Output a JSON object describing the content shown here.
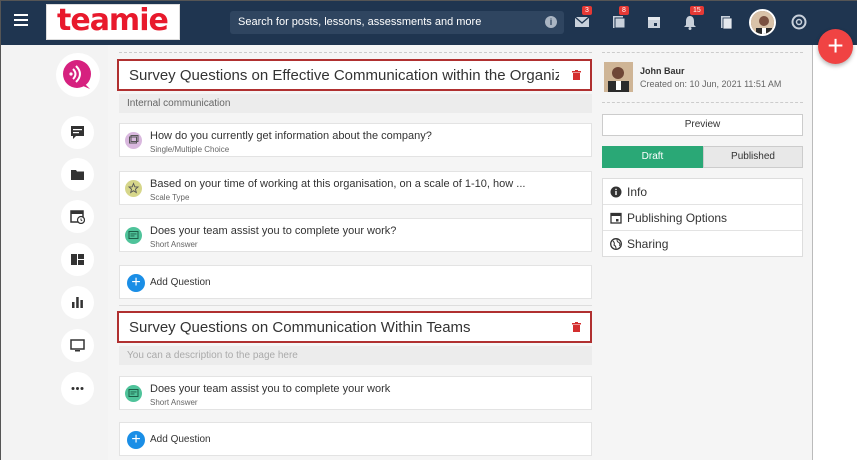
{
  "header": {
    "logo_text": "teamie",
    "search_placeholder": "Search for posts, lessons, assessments and more",
    "badges": {
      "messages": "3",
      "lessons": "8",
      "notifications": "15"
    }
  },
  "sections": [
    {
      "title": "Survey Questions on Effective Communication within the Organiz",
      "description": "Internal communication",
      "questions": [
        {
          "title": "How do you currently get information about the company?",
          "type": "Single/Multiple Choice",
          "color": "#d9b8de"
        },
        {
          "title": "Based on your time of working at this organisation, on a scale of 1-10, how ...",
          "type": "Scale Type",
          "color": "#d6d68a"
        },
        {
          "title": "Does your team assist you to complete your work?",
          "type": "Short Answer",
          "color": "#4fc39a"
        }
      ],
      "add_label": "Add Question"
    },
    {
      "title": "Survey Questions on Communication Within Teams",
      "description": "You can a description to the page here",
      "questions": [
        {
          "title": "Does your team assist you to complete your work",
          "type": "Short Answer",
          "color": "#4fc39a"
        }
      ],
      "add_label": "Add Question"
    }
  ],
  "sidebar_right": {
    "author_name": "John Baur",
    "created": "Created on: 10 Jun, 2021 11:51 AM",
    "preview_label": "Preview",
    "draft_label": "Draft",
    "published_label": "Published",
    "menu": [
      {
        "label": "Info",
        "icon": "info-icon"
      },
      {
        "label": "Publishing Options",
        "icon": "calendar-icon"
      },
      {
        "label": "Sharing",
        "icon": "globe-icon"
      }
    ]
  },
  "colors": {
    "topbar": "#1f3550",
    "accent_red": "#e8192c",
    "draft_green": "#2aa876",
    "add_blue": "#1a8ee6",
    "fab": "#f04343"
  }
}
